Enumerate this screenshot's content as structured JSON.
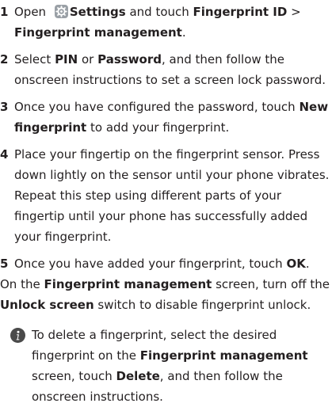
{
  "steps": [
    {
      "num": "1",
      "parts": [
        "Open",
        "Settings",
        "and touch",
        "Fingerprint ID",
        ">",
        "Fingerprint management",
        "."
      ]
    },
    {
      "num": "2",
      "parts": [
        "Select",
        "PIN",
        "or",
        "Password",
        ", and then follow the onscreen instructions to set a screen lock password."
      ]
    },
    {
      "num": "3",
      "parts": [
        "Once you have configured the password, touch",
        "New fingerprint",
        "to add your fingerprint."
      ]
    },
    {
      "num": "4",
      "parts": [
        "Place your fingertip on the fingerprint sensor. Press down lightly on the sensor until your phone vibrates. Repeat this step using different parts of your fingertip until your phone has successfully added your fingerprint."
      ]
    },
    {
      "num": "5",
      "parts": [
        "Once you have added your fingerprint, touch",
        "OK",
        "."
      ]
    }
  ],
  "continuation": {
    "parts": [
      "On the",
      "Fingerprint management",
      "screen, turn off the",
      "Unlock screen",
      "switch to disable fingerprint unlock."
    ]
  },
  "note": {
    "icon": "info-icon",
    "parts": [
      "To delete a fingerprint, select the desired fingerprint on the",
      "Fingerprint management",
      "screen, touch",
      "Delete",
      ", and then follow the onscreen instructions."
    ]
  },
  "icons": {
    "settings": "settings-gear-icon",
    "note": "info-icon"
  }
}
